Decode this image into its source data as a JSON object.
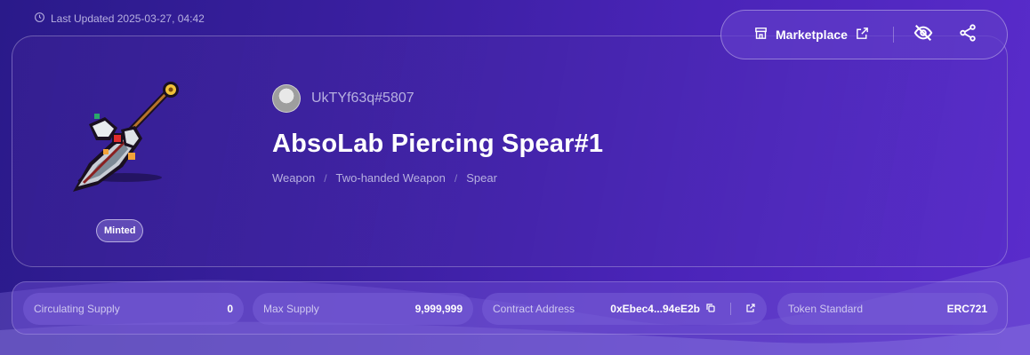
{
  "header": {
    "last_updated": "Last Updated 2025-03-27, 04:42"
  },
  "toolbar": {
    "marketplace_label": "Marketplace"
  },
  "nft": {
    "status_badge": "Minted",
    "owner": "UkTYf63q#5807",
    "title": "AbsoLab Piercing Spear#1",
    "breadcrumb": [
      "Weapon",
      "Two-handed Weapon",
      "Spear"
    ]
  },
  "stats": {
    "circulating_supply_label": "Circulating Supply",
    "circulating_supply_value": "0",
    "max_supply_label": "Max Supply",
    "max_supply_value": "9,999,999",
    "contract_address_label": "Contract Address",
    "contract_address_value": "0xEbec4...94eE2b",
    "token_standard_label": "Token Standard",
    "token_standard_value": "ERC721"
  },
  "icons": {
    "clock": "clock-icon",
    "store": "store-icon",
    "external_link": "external-link-icon",
    "hide": "eye-off-icon",
    "share": "share-icon",
    "copy": "copy-icon"
  },
  "colors": {
    "background_start": "#2a1a8a",
    "background_end": "#5a2ccc",
    "muted_text": "#b7b0e0"
  }
}
